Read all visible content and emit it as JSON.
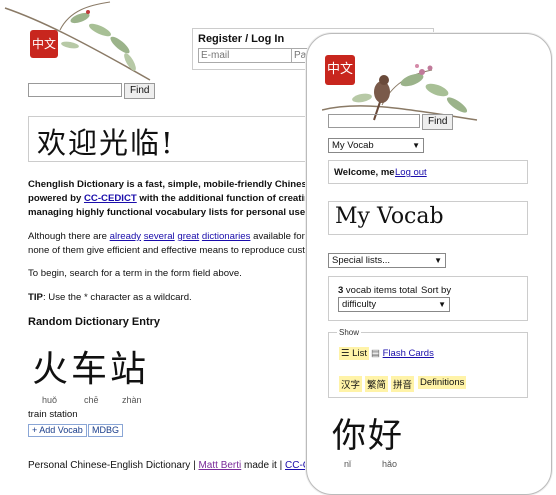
{
  "desktop": {
    "logo_char": "中文",
    "login": {
      "title": "Register / Log In",
      "email_placeholder": "E-mail",
      "password_placeholder": "Pas"
    },
    "search": {
      "button": "Find"
    },
    "welcome": "欢迎光临!",
    "intro": {
      "line1": "Chenglish Dictionary is a fast, simple, mobile-friendly Chinese",
      "line2_pre": "powered by ",
      "line2_link": "CC-CEDICT",
      "line2_post": " with the additional function of creating",
      "line3": "managing highly functional vocabulary lists for personal use a"
    },
    "para2": {
      "pre": "Although there are ",
      "link1": "already",
      "link2": "several",
      "link3": "great",
      "link4": "dictionaries",
      "post": " available for C",
      "line2": "none of them give efficient and effective means to reproduce custom"
    },
    "para3": "To begin, search for a term in the form field above.",
    "tip": {
      "label": "TIP",
      "text": ": Use the * character as a wildcard."
    },
    "random_title": "Random Dictionary Entry",
    "random_entry": {
      "hanzi": "火车站",
      "pinyin": [
        "huǒ",
        "chē",
        "zhàn"
      ],
      "meaning": "train station",
      "add_vocab": "+ Add Vocab",
      "mdbg": "MDBG"
    },
    "footer": {
      "pre": "Personal Chinese-English Dictionary | ",
      "author": "Matt Berti",
      "mid": " made it | ",
      "link": "CC-CEDI"
    }
  },
  "phone": {
    "logo_char": "中文",
    "search_button": "Find",
    "list_select": "My Vocab",
    "welcome_label": "Welcome, me",
    "logout": "Log out",
    "title": "My Vocab",
    "special_lists": "Special lists...",
    "count": "3",
    "count_text": " vocab items total",
    "sort_label": "Sort by",
    "sort_value": "difficulty",
    "show_legend": "Show",
    "list_tab": "List",
    "flashcards_tab": "Flash Cards",
    "toggles": [
      "汉字",
      "繁简",
      "拼音",
      "Definitions"
    ],
    "entry_hanzi": "你好",
    "entry_pinyin": [
      "nǐ",
      "hǎo"
    ]
  }
}
